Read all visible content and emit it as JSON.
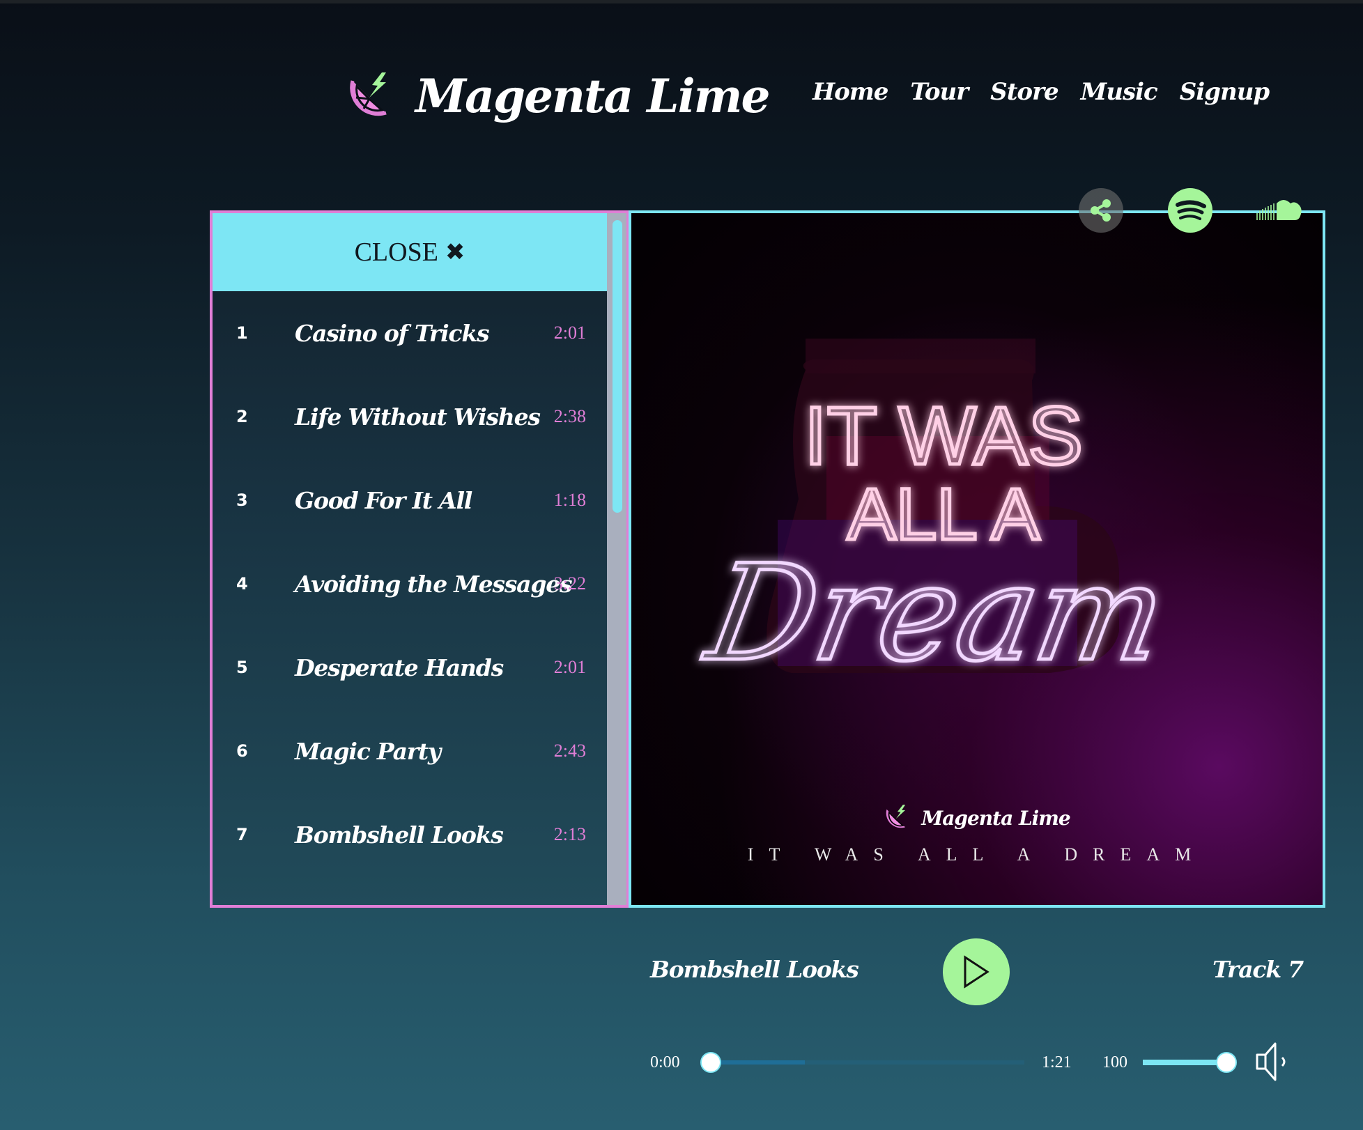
{
  "brand": {
    "name": "Magenta Lime"
  },
  "nav": {
    "items": [
      "Home",
      "Tour",
      "Store",
      "Music",
      "Signup"
    ]
  },
  "colors": {
    "magenta": "#e07ed6",
    "cyan": "#7de6f4",
    "lime": "#a5f59a"
  },
  "social": {
    "icons": [
      "share-icon",
      "spotify-icon",
      "soundcloud-icon"
    ]
  },
  "playlist": {
    "close_label": "CLOSE",
    "close_icon": "✖",
    "tracks": [
      {
        "num": "1",
        "title": "Casino of Tricks",
        "duration": "2:01"
      },
      {
        "num": "2",
        "title": "Life Without Wishes",
        "duration": "2:38"
      },
      {
        "num": "3",
        "title": "Good For It All",
        "duration": "1:18"
      },
      {
        "num": "4",
        "title": "Avoiding the Messages",
        "duration": "3:22"
      },
      {
        "num": "5",
        "title": "Desperate Hands",
        "duration": "2:01"
      },
      {
        "num": "6",
        "title": "Magic Party",
        "duration": "2:43"
      },
      {
        "num": "7",
        "title": "Bombshell Looks",
        "duration": "2:13"
      }
    ]
  },
  "album": {
    "neon_line1": "IT WAS",
    "neon_line2": "ALL A",
    "neon_line3": "Dream",
    "art_brand": "Magenta Lime",
    "art_subtitle": "IT WAS ALL A DREAM"
  },
  "player": {
    "now_playing": "Bombshell Looks",
    "track_label": "Track 7",
    "current_time": "0:00",
    "duration": "1:21",
    "progress_fraction": 0,
    "buffered_fraction": 0.3,
    "volume": "100",
    "volume_fraction": 1.0
  }
}
